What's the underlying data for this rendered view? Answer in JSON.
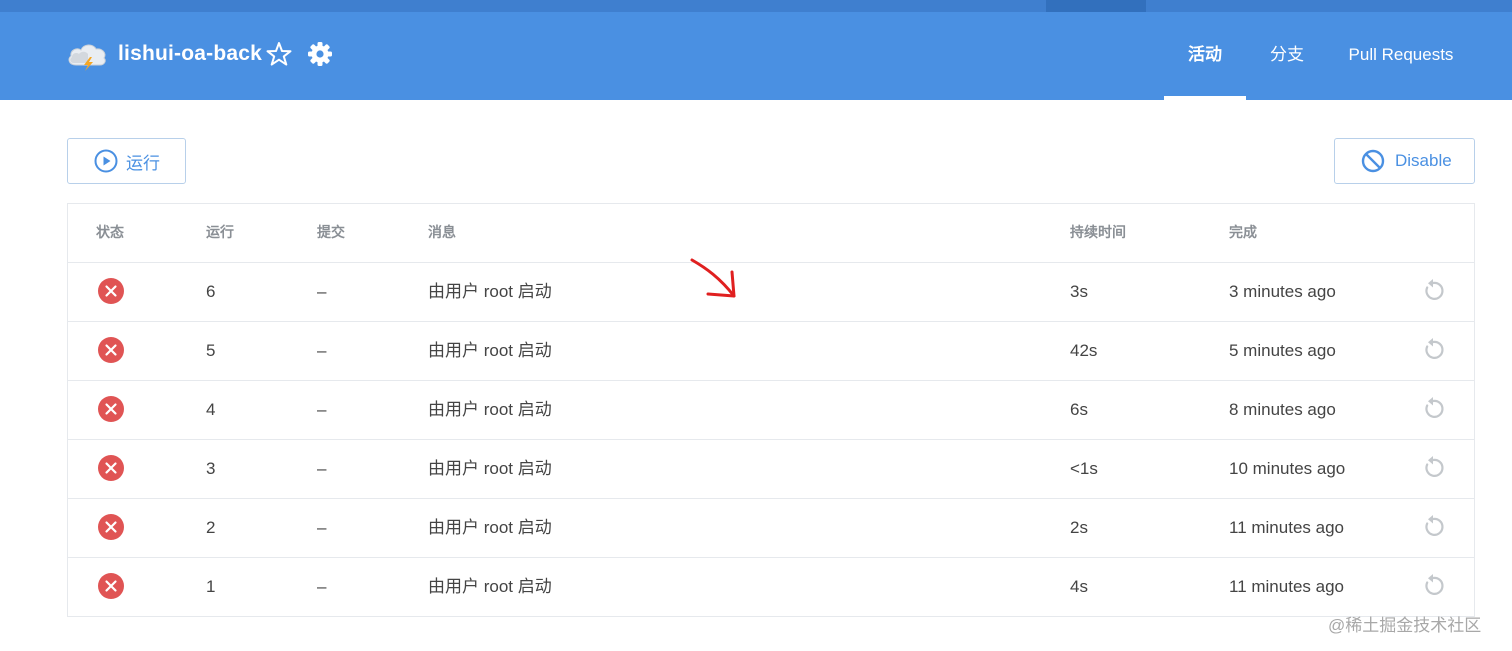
{
  "header": {
    "repo_name": "lishui-oa-back",
    "tabs": [
      {
        "label": "活动",
        "active": true
      },
      {
        "label": "分支",
        "active": false
      },
      {
        "label": "Pull Requests",
        "active": false
      }
    ]
  },
  "toolbar": {
    "run_label": "运行",
    "disable_label": "Disable"
  },
  "table": {
    "columns": [
      "状态",
      "运行",
      "提交",
      "消息",
      "持续时间",
      "完成"
    ],
    "rows": [
      {
        "status": "failed",
        "run": "6",
        "commit": "–",
        "message": "由用户 root 启动",
        "duration": "3s",
        "finished": "3 minutes ago"
      },
      {
        "status": "failed",
        "run": "5",
        "commit": "–",
        "message": "由用户 root 启动",
        "duration": "42s",
        "finished": "5 minutes ago"
      },
      {
        "status": "failed",
        "run": "4",
        "commit": "–",
        "message": "由用户 root 启动",
        "duration": "6s",
        "finished": "8 minutes ago"
      },
      {
        "status": "failed",
        "run": "3",
        "commit": "–",
        "message": "由用户 root 启动",
        "duration": "<1s",
        "finished": "10 minutes ago"
      },
      {
        "status": "failed",
        "run": "2",
        "commit": "–",
        "message": "由用户 root 启动",
        "duration": "2s",
        "finished": "11 minutes ago"
      },
      {
        "status": "failed",
        "run": "1",
        "commit": "–",
        "message": "由用户 root 启动",
        "duration": "4s",
        "finished": "11 minutes ago"
      }
    ]
  },
  "icons": {
    "logo": "cloud-lightning-icon",
    "star": "star-icon",
    "settings": "gear-icon",
    "run": "play-circle-icon",
    "disable": "ban-icon",
    "status_failed": "x-circle-icon",
    "retry": "retry-icon"
  },
  "colors": {
    "header": "#4a90e2",
    "accent": "#4a90e2",
    "failed": "#e05454",
    "annotation": "#e02020"
  },
  "watermark": "@稀土掘金技术社区"
}
